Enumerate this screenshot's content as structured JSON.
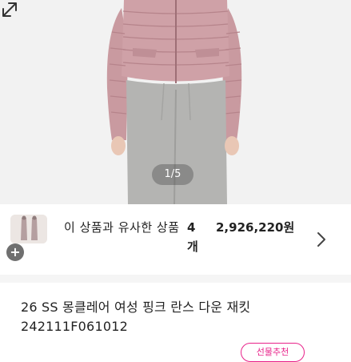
{
  "gallery": {
    "counter": "1/5",
    "expand_icon": "expand-icon"
  },
  "similar": {
    "label": "이 상품과 유사한 상품",
    "count": "4개",
    "price": "2,926,220원",
    "add_icon": "plus-icon",
    "chevron_icon": "chevron-right-icon"
  },
  "product": {
    "title": "26 SS 몽클레어 여성 핑크 란스 다운 재킷 242111F061012",
    "tag": "선물추천"
  },
  "colors": {
    "jacket": "#c99aa0",
    "pants": "#b3b3b1",
    "tag": "#e8228a"
  }
}
